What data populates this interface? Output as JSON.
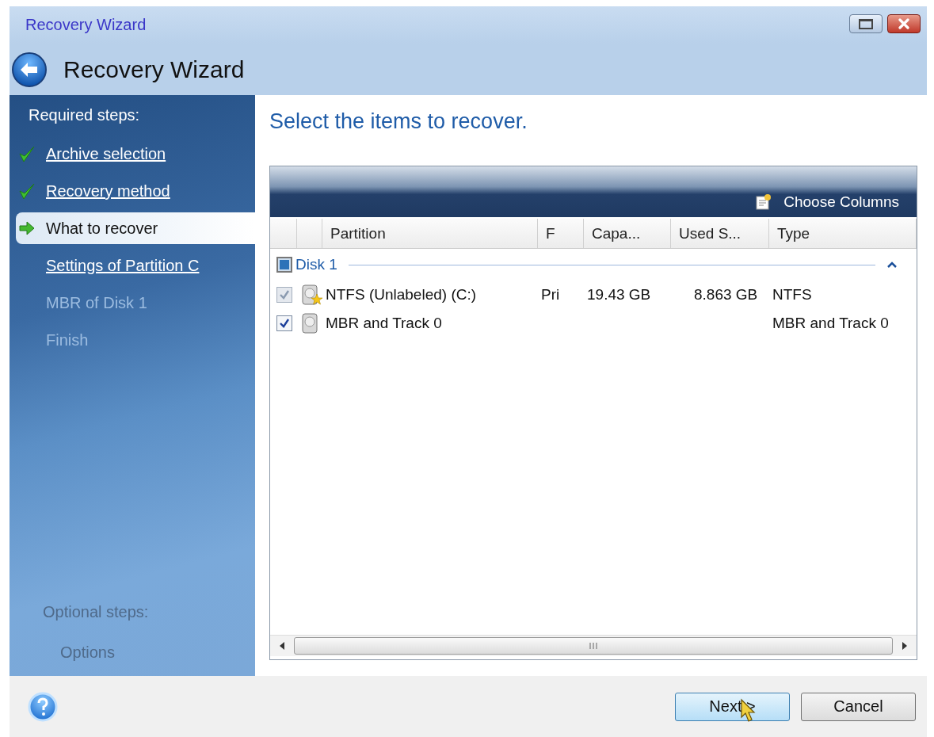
{
  "window": {
    "title": "Recovery Wizard"
  },
  "header": {
    "title": "Recovery Wizard"
  },
  "sidebar": {
    "required_heading": "Required steps:",
    "required_steps": [
      {
        "label": "Archive selection",
        "kind": "done",
        "selected": false
      },
      {
        "label": "Recovery method",
        "kind": "done",
        "selected": false
      },
      {
        "label": "What to recover",
        "kind": "current",
        "selected": true
      },
      {
        "label": "Settings of Partition C",
        "kind": "link",
        "selected": false
      },
      {
        "label": "MBR of Disk 1",
        "kind": "disabled",
        "selected": false
      },
      {
        "label": "Finish",
        "kind": "disabled",
        "selected": false
      }
    ],
    "optional_heading": "Optional steps:",
    "optional_steps": [
      {
        "label": "Options",
        "kind": "disabled"
      }
    ]
  },
  "content": {
    "heading": "Select the items to recover.",
    "toolbar": {
      "choose_columns": "Choose Columns"
    },
    "table": {
      "columns": [
        "Partition",
        "F",
        "Capa...",
        "Used S...",
        "Type"
      ],
      "groups": [
        {
          "label": "Disk 1",
          "expanded": true,
          "rows": [
            {
              "kind": "partition",
              "name": "NTFS (Unlabeled) (C:)",
              "f": "Pri",
              "capacity": "19.43 GB",
              "used": "8.863 GB",
              "type": "NTFS",
              "checked": true,
              "disabled": true
            },
            {
              "kind": "mbr",
              "name": "MBR and Track 0",
              "type": "MBR and Track 0",
              "checked": true,
              "disabled": false
            }
          ]
        }
      ]
    }
  },
  "buttons": [
    {
      "label": "Next >",
      "kind": "primary"
    },
    {
      "label": "Cancel",
      "kind": "secondary"
    }
  ]
}
